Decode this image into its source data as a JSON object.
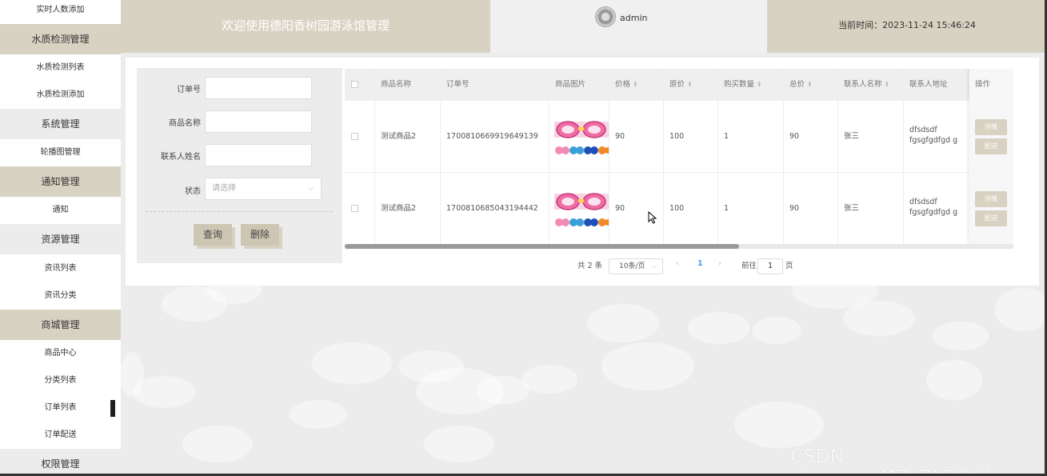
{
  "sidebar": {
    "items": [
      {
        "label": "实时人数添加",
        "kind": "sub"
      },
      {
        "label": "水质检测管理",
        "kind": "group"
      },
      {
        "label": "水质检测列表",
        "kind": "sub"
      },
      {
        "label": "水质检测添加",
        "kind": "sub"
      },
      {
        "label": "系统管理",
        "kind": "group"
      },
      {
        "label": "轮播图管理",
        "kind": "sub"
      },
      {
        "label": "通知管理",
        "kind": "group"
      },
      {
        "label": "通知",
        "kind": "sub"
      },
      {
        "label": "资源管理",
        "kind": "group"
      },
      {
        "label": "资讯列表",
        "kind": "sub"
      },
      {
        "label": "资讯分类",
        "kind": "sub"
      },
      {
        "label": "商城管理",
        "kind": "group"
      },
      {
        "label": "商品中心",
        "kind": "sub"
      },
      {
        "label": "分类列表",
        "kind": "sub"
      },
      {
        "label": "订单列表",
        "kind": "sub",
        "active": true
      },
      {
        "label": "订单配送",
        "kind": "sub"
      },
      {
        "label": "权限管理",
        "kind": "group"
      }
    ]
  },
  "header": {
    "title": "欢迎使用德阳香树园游泳馆管理",
    "username": "admin",
    "time_text": "当前时间：2023-11-24 15:46:24"
  },
  "search": {
    "order_no_label": "订单号",
    "product_name_label": "商品名称",
    "contact_name_label": "联系人姓名",
    "status_label": "状态",
    "status_placeholder": "请选择",
    "query_button": "查询",
    "delete_button": "删除"
  },
  "table": {
    "headers": [
      "商品名称",
      "订单号",
      "商品图片",
      "价格",
      "原价",
      "购买数量",
      "总价",
      "联系人名称",
      "联系人地址",
      "操作"
    ],
    "rows": [
      {
        "name": "测试商品2",
        "order_no": "1700810669919649139",
        "price": "90",
        "original_price": "100",
        "quantity": "1",
        "total": "90",
        "contact": "张三",
        "address": "dfsdsdf fgsgfgdfgd g",
        "detail": "详情",
        "deliver": "配送"
      },
      {
        "name": "测试商品2",
        "order_no": "1700810685043194442",
        "price": "90",
        "original_price": "100",
        "quantity": "1",
        "total": "90",
        "contact": "张三",
        "address": "dfsdsdf fgsgfgdfgd g",
        "detail": "详情",
        "deliver": "配送"
      }
    ]
  },
  "pagination": {
    "total_text": "共 2 条",
    "page_size": "10条/页",
    "current_page": "1",
    "goto_label": "前往",
    "goto_value": "1",
    "page_suffix": "页"
  },
  "watermark": "CSDN @weixin_MZ_ZXD001",
  "colors": {
    "accent": "#d8d2c2",
    "button": "#cdc6b3",
    "background": "#ececec"
  }
}
